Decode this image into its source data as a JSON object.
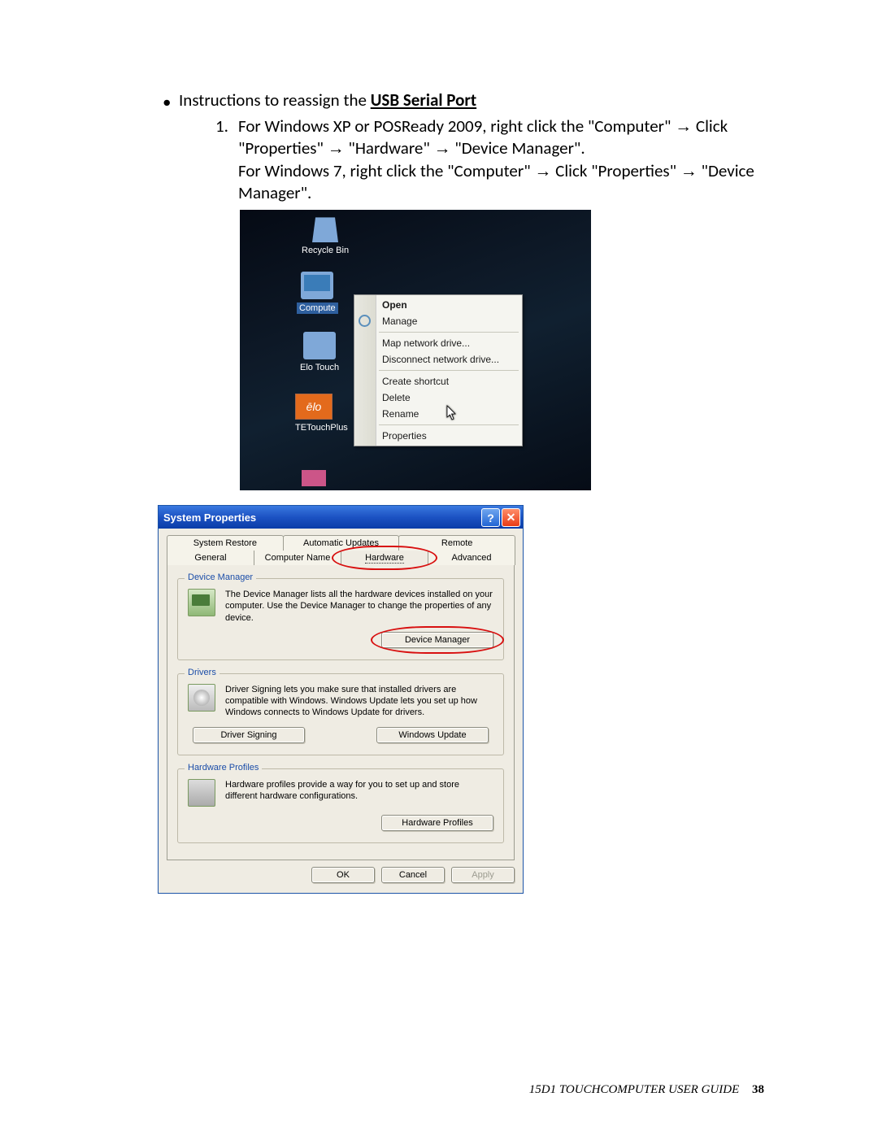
{
  "bullet": {
    "lead": "Instructions to reassign the ",
    "bold_underline": "USB Serial Port"
  },
  "step1": {
    "num": "1.",
    "line1a": "For Windows XP or POSReady 2009, right click the \"Computer\" ",
    "arrow": "→",
    "line1b": " Click \"Properties\" ",
    "line1c": " \"Hardware\" ",
    "line1d": " \"Device Manager\".",
    "line2a": "For Windows 7, right click the \"Computer\" ",
    "line2b": " Click \"Properties\" ",
    "line2c": " \"Device Manager\"."
  },
  "desktop": {
    "recycle": "Recycle Bin",
    "computer": "Compute",
    "elo_touch": "Elo Touch",
    "tetouch": "TETouchPlus",
    "elo_logo": "ēlo"
  },
  "context_menu": {
    "open": "Open",
    "manage": "Manage",
    "map": "Map network drive...",
    "disconnect": "Disconnect network drive...",
    "shortcut": "Create shortcut",
    "delete": "Delete",
    "rename": "Rename",
    "properties": "Properties"
  },
  "sysprops": {
    "title": "System Properties",
    "help": "?",
    "close": "✕",
    "tabs_row1": [
      "System Restore",
      "Automatic Updates",
      "Remote"
    ],
    "tabs_row2": [
      "General",
      "Computer Name",
      "Hardware",
      "Advanced"
    ],
    "dm": {
      "legend": "Device Manager",
      "text": "The Device Manager lists all the hardware devices installed on your computer. Use the Device Manager to change the properties of any device.",
      "btn": "Device Manager"
    },
    "drv": {
      "legend": "Drivers",
      "text": "Driver Signing lets you make sure that installed drivers are compatible with Windows. Windows Update lets you set up how Windows connects to Windows Update for drivers.",
      "btn1": "Driver Signing",
      "btn2": "Windows Update"
    },
    "hp": {
      "legend": "Hardware Profiles",
      "text": "Hardware profiles provide a way for you to set up and store different hardware configurations.",
      "btn": "Hardware Profiles"
    },
    "ok": "OK",
    "cancel": "Cancel",
    "apply": "Apply"
  },
  "footer": {
    "text": "15D1 TOUCHCOMPUTER USER GUIDE",
    "page": "38"
  }
}
